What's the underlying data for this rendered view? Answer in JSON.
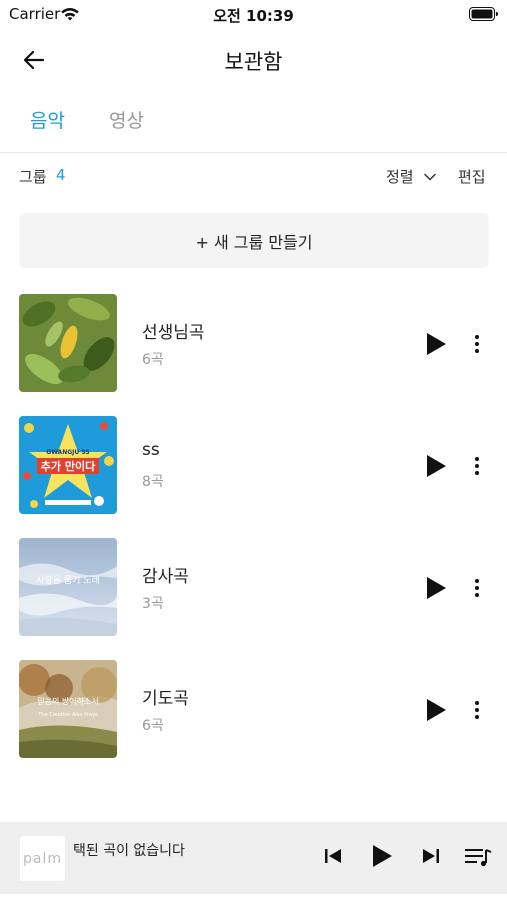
{
  "status_bar": {
    "carrier": "Carrier",
    "time": "오전 10:39"
  },
  "header": {
    "title": "보관함"
  },
  "tabs": [
    {
      "label": "음악",
      "active": true
    },
    {
      "label": "영상",
      "active": false
    }
  ],
  "toolbar": {
    "group_label": "그룹",
    "group_count": "4",
    "sort_label": "정렬",
    "edit_label": "편집"
  },
  "new_group_label": "+ 새 그룹 만들기",
  "groups": [
    {
      "title": "선생님곡",
      "count": "6곡",
      "thumb": "leaves"
    },
    {
      "title": "ss",
      "count": "8곡",
      "thumb": "star-poster",
      "thumb_text_top": "GWANGJU SS",
      "thumb_text_main": "추가 만이다"
    },
    {
      "title": "감사곡",
      "count": "3곡",
      "thumb": "clouds",
      "thumb_text_main": "사랑을 품기 노래"
    },
    {
      "title": "기도곡",
      "count": "6곡",
      "thumb": "autumn",
      "thumb_text_main": "믿음의 방어하소서",
      "thumb_text_sub": "The Creation Also Prays"
    }
  ],
  "player": {
    "logo_text": "palm",
    "message": "택된 곡이 없습니다"
  },
  "colors": {
    "accent": "#1a9fd6",
    "muted": "#999999",
    "player_bg": "#efefef"
  }
}
